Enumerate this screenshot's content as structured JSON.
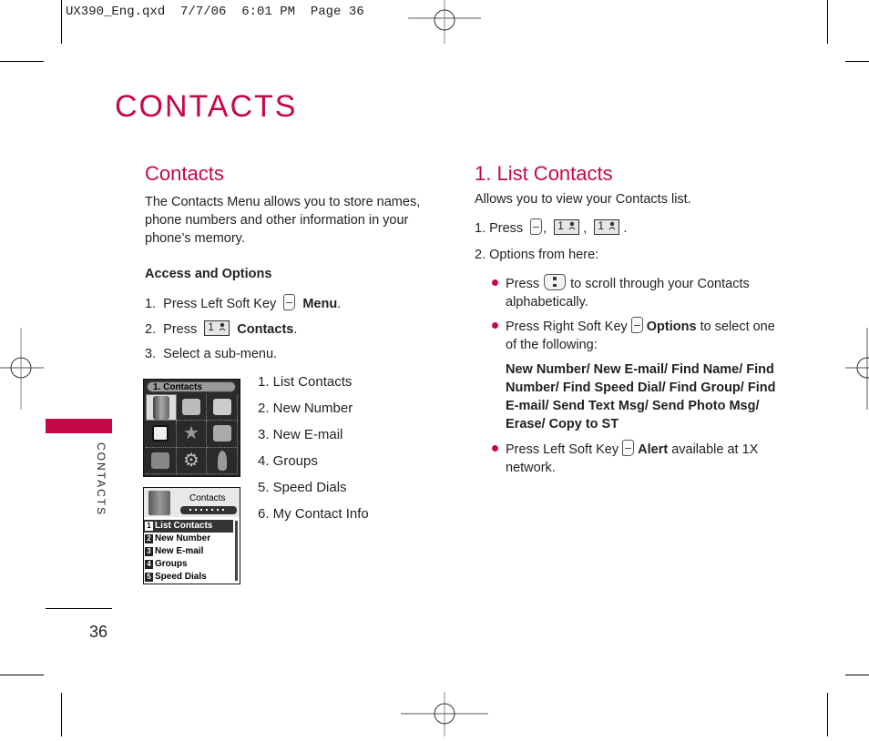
{
  "slug": "UX390_Eng.qxd  7/7/06  6:01 PM  Page 36",
  "chapter_title": "CONTACTS",
  "left_column": {
    "heading": "Contacts",
    "intro_lines": [
      "The Contacts Menu allows you to store names,",
      "phone numbers and other information in your",
      "phone’s memory."
    ],
    "subheading": "Access and Options",
    "steps": [
      {
        "num": "1.",
        "pre": "Press Left Soft Key",
        "icon": "left-soft-key-icon",
        "bold": "Menu",
        "post": "."
      },
      {
        "num": "2.",
        "pre": "Press",
        "icon": "key-1-contacts-icon",
        "key_label": "1",
        "bold": "Contacts",
        "post": "."
      },
      {
        "num": "3.",
        "pre": "Select a sub-menu.",
        "icon": "",
        "bold": "",
        "post": ""
      }
    ],
    "submenu": [
      "1. List Contacts",
      "2. New Number",
      "3. New E-mail",
      "4. Groups",
      "5. Speed Dials",
      "6. My Contact Info"
    ],
    "screen1": {
      "title": "1. Contacts"
    },
    "screen2": {
      "title": "Contacts",
      "items": [
        {
          "num": "1",
          "label": "List Contacts"
        },
        {
          "num": "2",
          "label": "New Number"
        },
        {
          "num": "3",
          "label": "New E-mail"
        },
        {
          "num": "4",
          "label": "Groups"
        },
        {
          "num": "5",
          "label": "Speed Dials"
        }
      ]
    }
  },
  "right_column": {
    "heading": "1. List Contacts",
    "intro": "Allows you to view your Contacts list.",
    "step1_pre": "1. Press",
    "step1_sep": ",",
    "step1_end": ".",
    "key_label": "1",
    "step2": "2. Options from here:",
    "bullets": [
      {
        "pre": "Press",
        "icon": "nav-key-icon",
        "post_line1": "to scroll through your Contacts",
        "line2": "alphabetically."
      },
      {
        "pre": "Press Right Soft Key",
        "icon": "right-soft-key-icon",
        "bold": "Options",
        "post_line1": "to select one",
        "line2": "of the following:"
      },
      {
        "pre": "Press Left Soft Key",
        "icon": "left-soft-key-icon",
        "bold": "Alert",
        "post_line1": "available at 1X",
        "line2": "network."
      }
    ],
    "options_lines": [
      "New Number/ New E-mail/ Find Name/ Find",
      "Number/ Find Speed Dial/ Find Group/ Find",
      "E-mail/ Send Text Msg/ Send Photo Msg/",
      "Erase/ Copy to ST"
    ]
  },
  "side_tab": {
    "label": "CONTACTS",
    "color": "#c4084a"
  },
  "page_number": "36",
  "accent_color": "#c4084a"
}
